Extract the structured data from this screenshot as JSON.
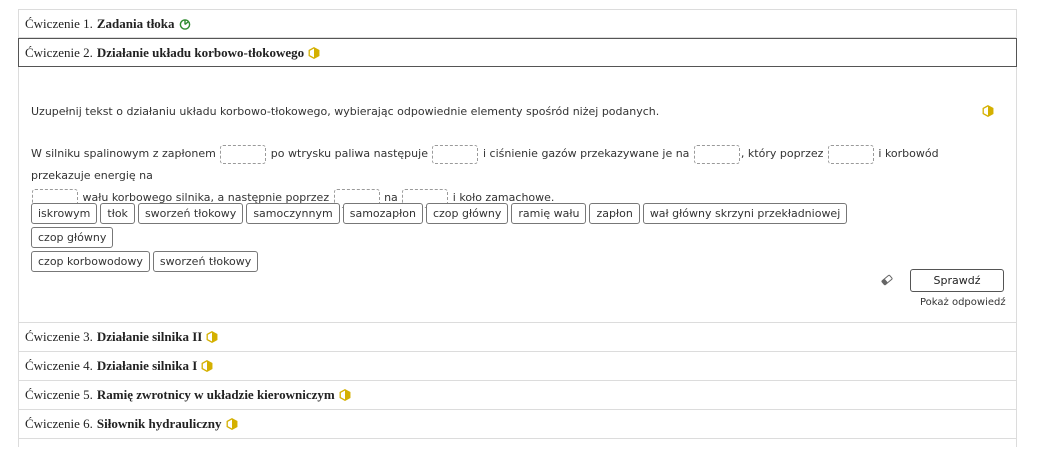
{
  "exercises": [
    {
      "prefix": "Ćwiczenie 1.",
      "title": "Zadania tłoka",
      "status": "complete",
      "status_color": "#2e8b2e"
    },
    {
      "prefix": "Ćwiczenie 2.",
      "title": "Działanie układu korbowo-tłokowego",
      "status": "partial",
      "status_color": "#d4b000"
    },
    {
      "prefix": "Ćwiczenie 3.",
      "title": "Działanie silnika II",
      "status": "partial",
      "status_color": "#d4b000"
    },
    {
      "prefix": "Ćwiczenie 4.",
      "title": "Działanie silnika I",
      "status": "partial",
      "status_color": "#d4b000"
    },
    {
      "prefix": "Ćwiczenie 5.",
      "title": "Ramię zwrotnicy w układzie kierowniczym",
      "status": "partial",
      "status_color": "#d4b000"
    },
    {
      "prefix": "Ćwiczenie 6.",
      "title": "Siłownik hydrauliczny",
      "status": "partial",
      "status_color": "#d4b000"
    }
  ],
  "active_exercise": {
    "instruction": "Uzupełnij tekst o działaniu układu korbowo-tłokowego, wybierając odpowiednie elementy spośród niżej podanych.",
    "text_segments": [
      "W silniku spalinowym z zapłonem ",
      " po wtrysku paliwa następuje ",
      " i ciśnienie gazów przekazywane je na ",
      ", który poprzez ",
      " i korbowód przekazuje energię na ",
      " wału korbowego silnika, a następnie poprzez ",
      " na ",
      " i koło zamachowe."
    ],
    "chips": [
      "iskrowym",
      "tłok",
      "sworzeń tłokowy",
      "samoczynnym",
      "samozapłon",
      "czop główny",
      "ramię wału",
      "zapłon",
      "wał główny skrzyni przekładniowej",
      "czop główny",
      "czop korbowodowy",
      "sworzeń tłokowy"
    ],
    "check_label": "Sprawdź",
    "show_answer_label": "Pokaż odpowiedź"
  }
}
